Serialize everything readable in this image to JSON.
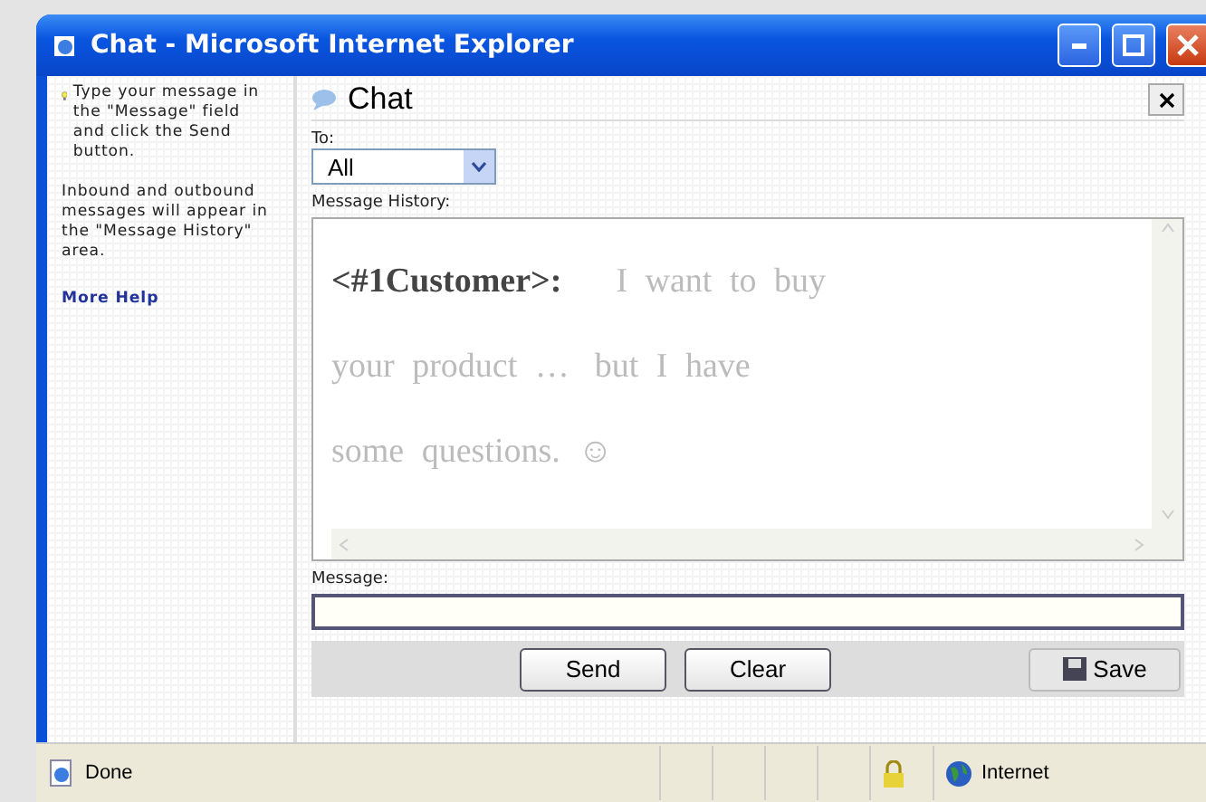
{
  "window": {
    "title": "Chat - Microsoft Internet Explorer"
  },
  "help": {
    "intro": "Type your message in the \"Message\" field and click the Send button.",
    "note": "Inbound and outbound messages will appear in the \"Message History\" area.",
    "link": "More Help"
  },
  "chat": {
    "title": "Chat",
    "to_label": "To:",
    "to_value": "All",
    "history_label": "Message History:",
    "history": {
      "sender": "<#1Customer>:",
      "lines": [
        [
          "I want to buy"
        ],
        [
          "your product …",
          "but I have"
        ],
        [
          "some questions. ☺"
        ]
      ]
    },
    "message_label": "Message:",
    "buttons": [
      {
        "label": "Send",
        "kind": "plain"
      },
      {
        "label": "Clear",
        "kind": "plain"
      },
      {
        "label": "Save",
        "kind": "save"
      }
    ]
  },
  "status_bar": {
    "status": "Done",
    "zone": "Internet"
  }
}
